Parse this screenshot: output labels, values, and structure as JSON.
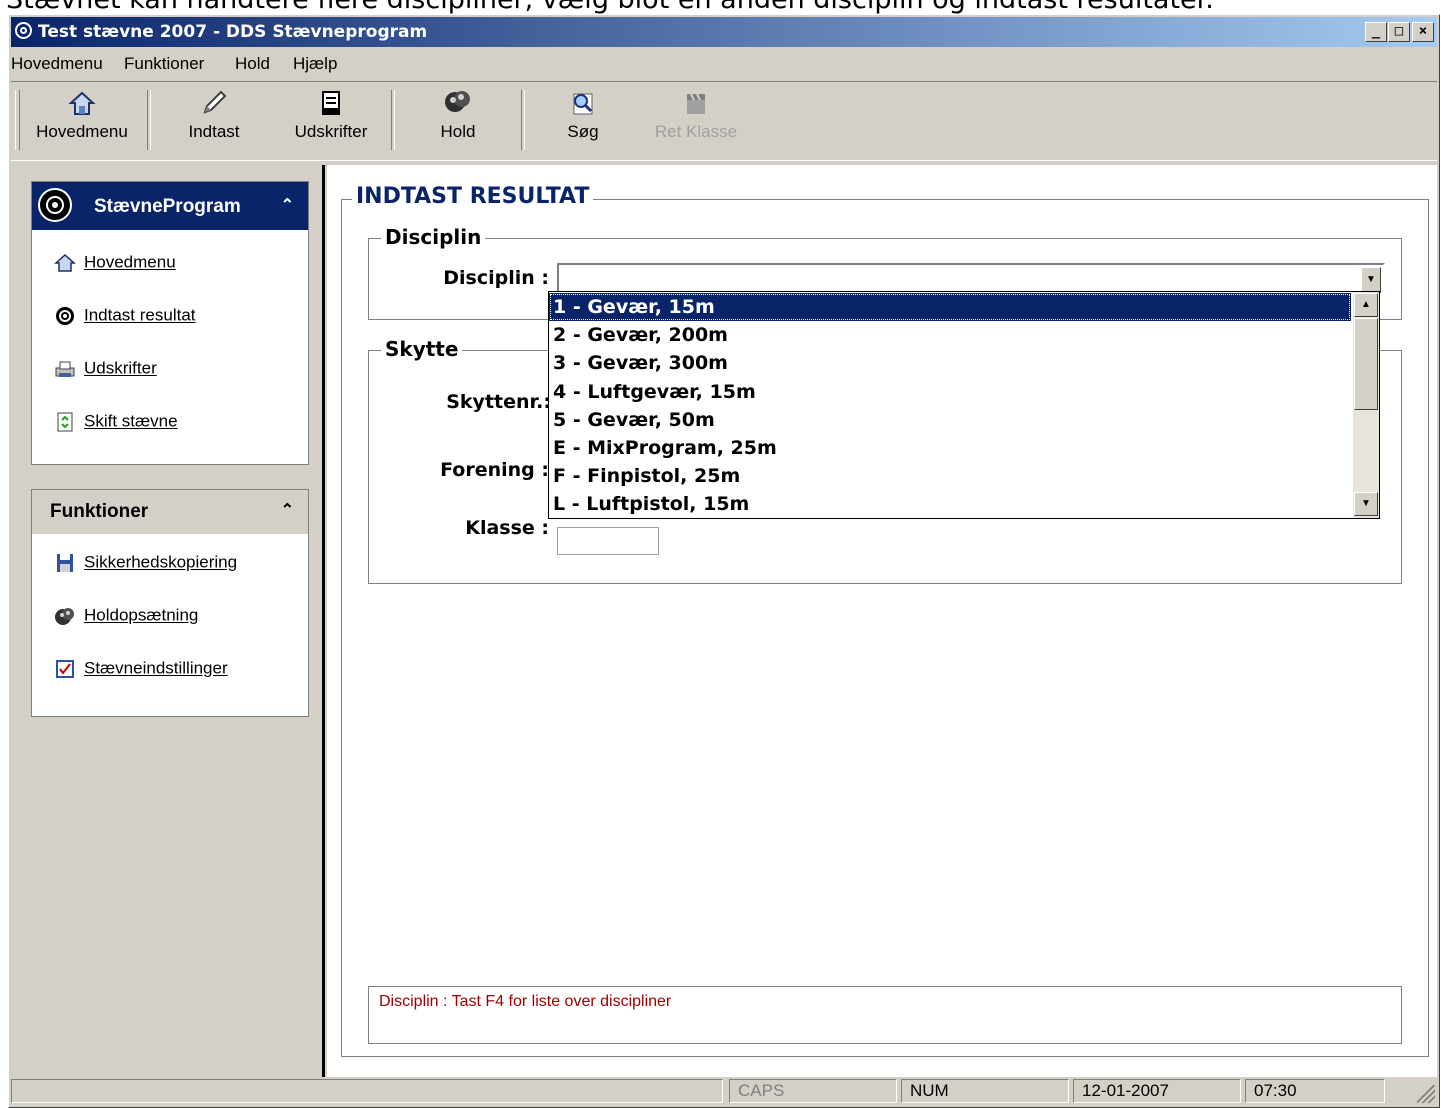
{
  "caption": "Stævnet kan håndtere flere discipliner, vælg blot en anden disciplin og indtast resultater.",
  "window": {
    "title": "Test stævne 2007 - DDS Stævneprogram",
    "buttons": {
      "minimize": "_",
      "maximize": "□",
      "close": "×"
    }
  },
  "menubar": [
    {
      "label": "Hovedmenu"
    },
    {
      "label": "Funktioner"
    },
    {
      "label": "Hold"
    },
    {
      "label": "Hjælp"
    }
  ],
  "toolbar": {
    "buttons": [
      {
        "label": "Hovedmenu",
        "icon": "house-icon"
      },
      {
        "label": "Indtast",
        "icon": "pencil-icon"
      },
      {
        "label": "Udskrifter",
        "icon": "document-icon"
      },
      {
        "label": "Hold",
        "icon": "team-icon"
      },
      {
        "label": "Søg",
        "icon": "search-icon"
      },
      {
        "label": "Ret Klasse",
        "icon": "clapper-icon",
        "disabled": true
      }
    ]
  },
  "sidebar": {
    "program_panel": {
      "title": "StævneProgram",
      "items": [
        {
          "label": "Hovedmenu",
          "icon": "house-icon"
        },
        {
          "label": "Indtast resultat",
          "icon": "target-icon"
        },
        {
          "label": "Udskrifter",
          "icon": "printer-icon"
        },
        {
          "label": "Skift stævne",
          "icon": "swap-icon"
        }
      ]
    },
    "functions_panel": {
      "title": "Funktioner",
      "items": [
        {
          "label": "Sikkerhedskopiering",
          "icon": "floppy-icon"
        },
        {
          "label": "Holdopsætning",
          "icon": "team-icon"
        },
        {
          "label": "Stævneindstillinger",
          "icon": "settings-check-icon"
        }
      ]
    }
  },
  "form": {
    "title": "INDTAST RESULTAT",
    "discipline_group": {
      "title": "Disciplin",
      "label": "Disciplin :",
      "value": ""
    },
    "shooter_group": {
      "title": "Skytte",
      "shooter_no_label": "Skyttenr.:",
      "club_label": "Forening :",
      "class_label": "Klasse :"
    },
    "dropdown_options": [
      "1 - Gevær, 15m",
      "2 - Gevær, 200m",
      "3 - Gevær, 300m",
      "4 - Luftgevær, 15m",
      "5 - Gevær, 50m",
      "E - MixProgram, 25m",
      "F - Finpistol, 25m",
      "L - Luftpistol, 15m"
    ],
    "selected_option_index": 0,
    "hint": "Disciplin : Tast F4 for liste over discipliner"
  },
  "statusbar": {
    "caps": "CAPS",
    "num": "NUM",
    "date": "12-01-2007",
    "time": "07:30"
  },
  "colors": {
    "title_blue": "#0a246a",
    "face": "#d4d0c8",
    "hint_red": "#a00000"
  }
}
